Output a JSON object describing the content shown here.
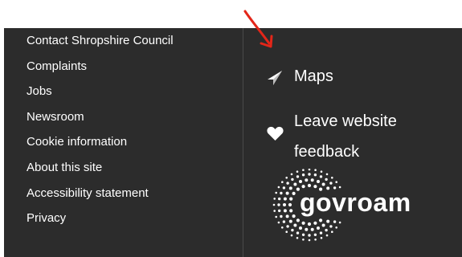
{
  "footer": {
    "links": [
      {
        "label": "Contact Shropshire Council"
      },
      {
        "label": "Complaints"
      },
      {
        "label": "Jobs"
      },
      {
        "label": "Newsroom"
      },
      {
        "label": "Cookie information"
      },
      {
        "label": "About this site"
      },
      {
        "label": "Accessibility statement"
      },
      {
        "label": "Privacy"
      }
    ],
    "maps_label": "Maps",
    "maps_icon": "compass-icon",
    "feedback_label": "Leave website feedback",
    "feedback_icon": "heart-icon",
    "logo_text": "govroam"
  },
  "colors": {
    "background": "#2c2c2c",
    "text": "#ffffff",
    "annotation": "#e32619"
  }
}
